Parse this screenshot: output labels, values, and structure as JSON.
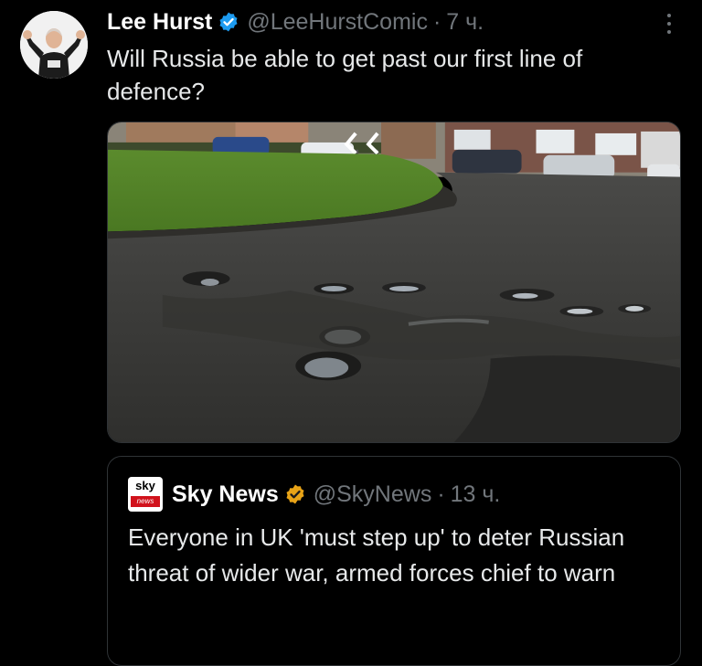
{
  "tweet": {
    "author_name": "Lee Hurst",
    "handle": "@LeeHurstComic",
    "separator": "·",
    "time": "7 ч.",
    "text": "Will Russia be able to get past our first line of defence?",
    "media": {
      "icon": "pothole-road-photo"
    }
  },
  "quote": {
    "author_name": "Sky News",
    "handle": "@SkyNews",
    "separator": "·",
    "time": "13 ч.",
    "logo": {
      "top": "sky",
      "bottom": "news"
    },
    "text": "Everyone in UK 'must step up' to deter Russian threat of wider war, armed forces chief to warn"
  },
  "colors": {
    "background": "#000000",
    "text": "#e7e9ea",
    "muted": "#71767b",
    "verified_blue": "#1d9bf0",
    "verified_gold": "#e8a317",
    "sky_red": "#d1121c"
  }
}
